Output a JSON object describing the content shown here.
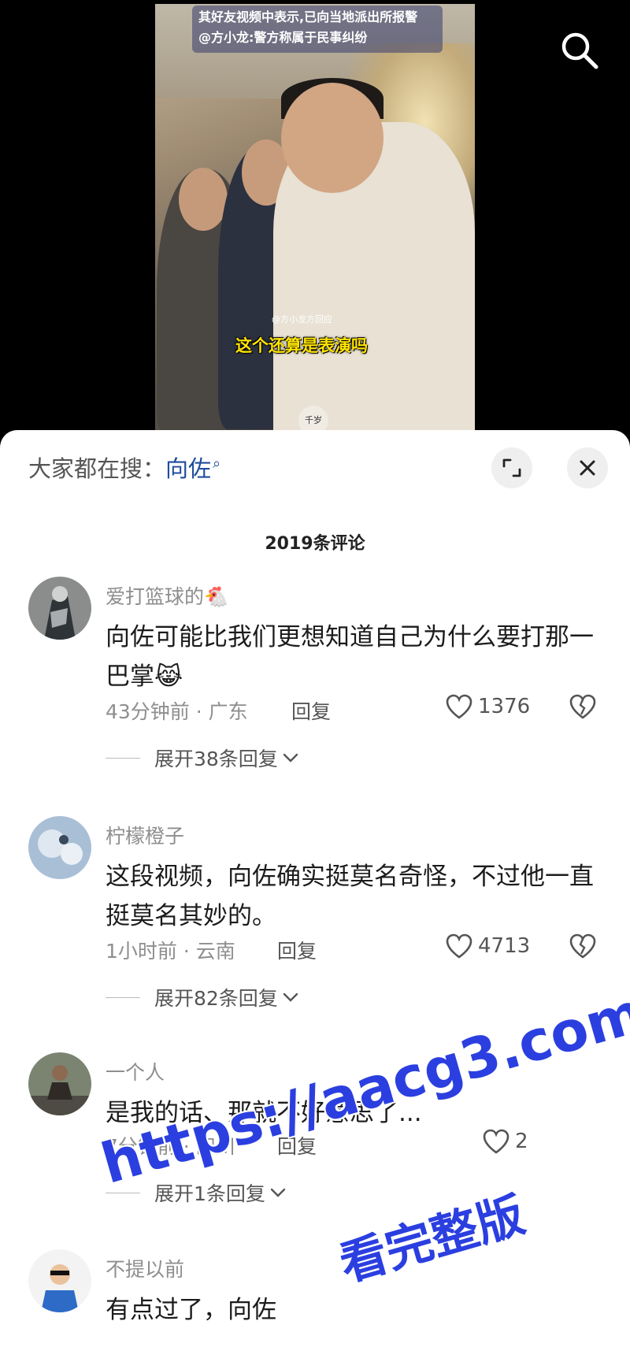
{
  "video": {
    "caption_line1": "其好友视频中表示,已向当地派出所报警",
    "caption_line2": "@方小龙:警方称属于民事纠纷",
    "tag": "@方小龙方回应",
    "subtitle": "这个还算是表演吗",
    "watermark": "千岁"
  },
  "sheet": {
    "hot_search_prefix": "大家都在搜：",
    "hot_search_keyword": "向佐",
    "comment_count": "2019条评论"
  },
  "comments": [
    {
      "user": "爱打篮球的🐔",
      "text": "向佐可能比我们更想知道自己为什么要打那一巴掌😹",
      "time_location": "43分钟前 · 广东",
      "reply_label": "回复",
      "likes": "1376",
      "expand": "展开38条回复"
    },
    {
      "user": "柠檬橙子",
      "text": "这段视频，向佐确实挺莫名奇怪，不过他一直挺莫名其妙的。",
      "time_location": "1小时前 · 云南",
      "reply_label": "回复",
      "likes": "4713",
      "expand": "展开82条回复"
    },
    {
      "user": "一个人",
      "text": "是我的话、那就不好意思了...",
      "time_location": "7分钟前 · 四川",
      "reply_label": "回复",
      "likes": "2",
      "expand": "展开1条回复"
    },
    {
      "user": "不提以前",
      "text": "有点过了，向佐",
      "time_location": "",
      "reply_label": "",
      "likes": "",
      "expand": ""
    }
  ],
  "overlay": {
    "url": "https://aacg3.com",
    "full_version": "看完整版"
  },
  "colors": {
    "keyword": "#1f4d9c",
    "watermark": "#2b3fe0",
    "subtitle": "#ffe400"
  }
}
